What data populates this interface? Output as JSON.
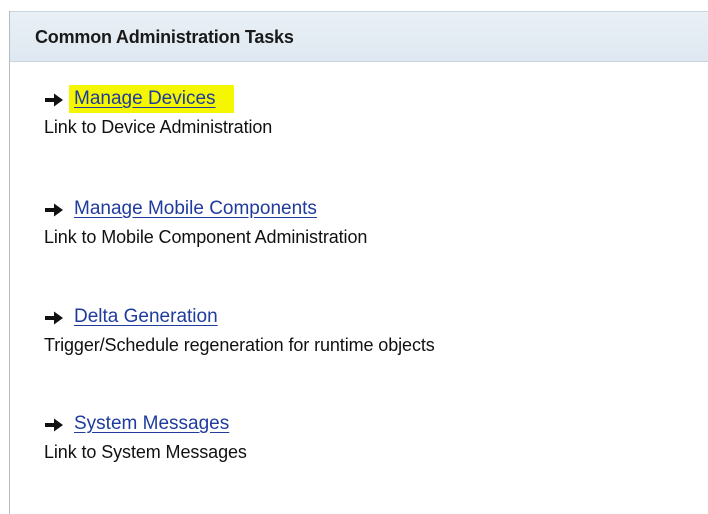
{
  "panel": {
    "title": "Common Administration Tasks"
  },
  "tasks": [
    {
      "link": "Manage Devices",
      "description": "Link to Device Administration",
      "highlighted": true,
      "icon": "arrow-right-icon"
    },
    {
      "link": "Manage Mobile Components",
      "description": "Link to Mobile Component Administration",
      "highlighted": false,
      "icon": "arrow-right-icon"
    },
    {
      "link": "Delta Generation",
      "description": "Trigger/Schedule regeneration for runtime objects",
      "highlighted": false,
      "icon": "arrow-right-icon"
    },
    {
      "link": "System Messages",
      "description": "Link to System Messages",
      "highlighted": false,
      "icon": "arrow-right-icon"
    }
  ],
  "colors": {
    "link": "#1f3b9e",
    "highlight": "#f4f700",
    "header_bg": "#e3ebf3",
    "panel_border": "#b3bdc8"
  }
}
